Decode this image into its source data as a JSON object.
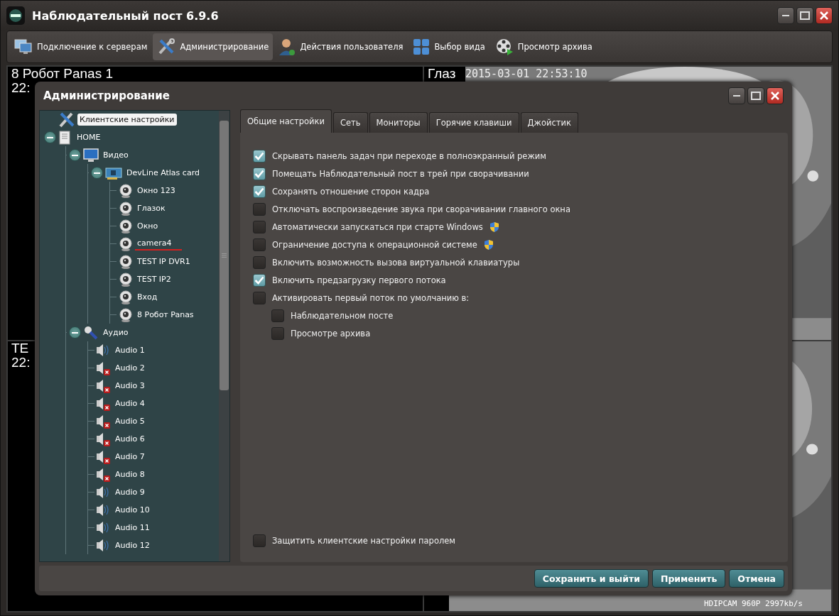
{
  "window": {
    "title": "Наблюдательный пост 6.9.6"
  },
  "toolbar": [
    {
      "kind": "servers",
      "label": "Подключение к серверам",
      "selected": false
    },
    {
      "kind": "admin",
      "label": "Администрирование",
      "selected": true
    },
    {
      "kind": "user",
      "label": "Действия пользователя",
      "selected": false
    },
    {
      "kind": "layout",
      "label": "Выбор вида",
      "selected": false
    },
    {
      "kind": "archive",
      "label": "Просмотр архива",
      "selected": false
    }
  ],
  "video_tiles": [
    {
      "lines": [
        "8 Робот Panas 1",
        "22:"
      ],
      "kind": "black"
    },
    {
      "lines": [
        "Глаз"
      ],
      "timestamp": "2015-03-01 22:53:10",
      "kind": "picture"
    },
    {
      "lines": [
        "TE",
        "22:"
      ],
      "kind": "black"
    },
    {
      "info": "HDIPCAM 960P 2997kb/s",
      "kind": "picture"
    }
  ],
  "dialog": {
    "title": "Администрирование",
    "tree": [
      {
        "kind": "settings",
        "label": "Клиентские настройки",
        "selected": true
      },
      {
        "kind": "server",
        "label": "HOME",
        "selected": false,
        "expanded": true,
        "children": [
          {
            "kind": "video",
            "label": "Видео",
            "selected": false,
            "expanded": true,
            "children": [
              {
                "kind": "card",
                "label": "DevLine Atlas card",
                "selected": false,
                "expanded": true,
                "children": [
                  {
                    "kind": "camera",
                    "label": "Окно 123",
                    "selected": false
                  },
                  {
                    "kind": "camera",
                    "label": "Глазок",
                    "selected": false
                  },
                  {
                    "kind": "camera",
                    "label": "Окно",
                    "selected": false
                  },
                  {
                    "kind": "camera",
                    "label": "camera4",
                    "selected": false,
                    "underlined": true
                  },
                  {
                    "kind": "camera",
                    "label": "TEST IP DVR1",
                    "selected": false
                  },
                  {
                    "kind": "camera",
                    "label": "TEST IP2",
                    "selected": false
                  },
                  {
                    "kind": "camera",
                    "label": "Вход",
                    "selected": false
                  },
                  {
                    "kind": "camera",
                    "label": "8 Робот Panas",
                    "selected": false
                  }
                ]
              }
            ]
          },
          {
            "kind": "audio-group",
            "label": "Аудио",
            "selected": false,
            "expanded": true,
            "children": [
              {
                "kind": "audio",
                "label": "Audio 1",
                "selected": false,
                "error": false
              },
              {
                "kind": "audio",
                "label": "Audio 2",
                "selected": false,
                "error": true
              },
              {
                "kind": "audio",
                "label": "Audio 3",
                "selected": false,
                "error": true
              },
              {
                "kind": "audio",
                "label": "Audio 4",
                "selected": false,
                "error": true
              },
              {
                "kind": "audio",
                "label": "Audio 5",
                "selected": false,
                "error": true
              },
              {
                "kind": "audio",
                "label": "Audio 6",
                "selected": false,
                "error": true
              },
              {
                "kind": "audio",
                "label": "Audio 7",
                "selected": false,
                "error": true
              },
              {
                "kind": "audio",
                "label": "Audio 8",
                "selected": false,
                "error": true
              },
              {
                "kind": "audio",
                "label": "Audio 9",
                "selected": false,
                "error": false
              },
              {
                "kind": "audio",
                "label": "Audio 10",
                "selected": false,
                "error": false
              },
              {
                "kind": "audio",
                "label": "Audio 11",
                "selected": false,
                "error": false
              },
              {
                "kind": "audio",
                "label": "Audio 12",
                "selected": false,
                "error": false
              }
            ]
          }
        ]
      }
    ],
    "tabs": [
      {
        "label": "Общие настройки",
        "selected": true
      },
      {
        "label": "Сеть",
        "selected": false
      },
      {
        "label": "Мониторы",
        "selected": false
      },
      {
        "label": "Горячие клавиши",
        "selected": false
      },
      {
        "label": "Джойстик",
        "selected": false
      }
    ],
    "options": [
      {
        "label": "Скрывать панель задач при переходе в полноэкранный режим",
        "checked": true,
        "shield": false
      },
      {
        "label": "Помещать Наблюдательный пост в трей при сворачивании",
        "checked": true,
        "shield": false
      },
      {
        "label": "Сохранять отношение сторон кадра",
        "checked": true,
        "shield": false
      },
      {
        "label": "Отключать воспроизведение звука при сворачивании главного окна",
        "checked": false,
        "shield": false
      },
      {
        "label": "Автоматически запускаться при старте Windows",
        "checked": false,
        "shield": true
      },
      {
        "label": "Ограничение доступа к операционной системе",
        "checked": false,
        "shield": true
      },
      {
        "label": "Включить возможность вызова виртуальной клавиатуры",
        "checked": false,
        "shield": false
      },
      {
        "label": "Включить предзагрузку первого потока",
        "checked": true,
        "shield": false
      },
      {
        "label": "Активировать первый поток по умолчанию в:",
        "checked": false,
        "shield": false,
        "children": [
          {
            "label": "Наблюдательном посте",
            "checked": false,
            "shield": false
          },
          {
            "label": "Просмотре архива",
            "checked": false,
            "shield": false
          }
        ]
      }
    ],
    "password_option": {
      "label": "Защитить клиентские настройки паролем",
      "checked": false
    },
    "buttons": [
      "Сохранить и выйти",
      "Применить",
      "Отмена"
    ]
  }
}
